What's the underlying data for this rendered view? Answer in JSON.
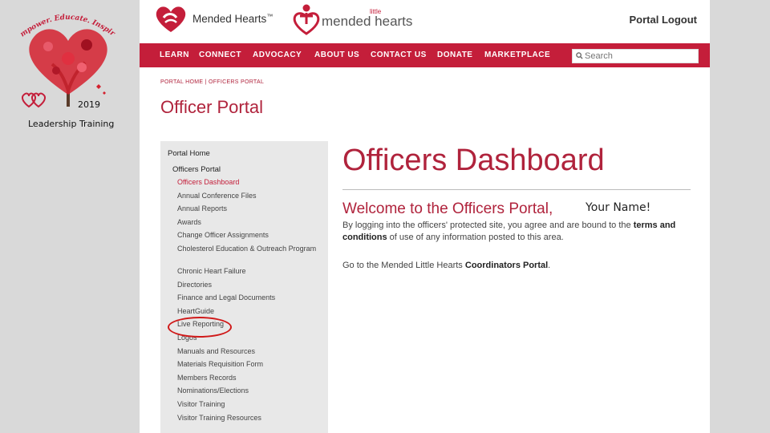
{
  "slide": {
    "arc_text": "Empower. Educate. Inspire.",
    "year": "2019",
    "subtitle": "Leadership Training",
    "colors": {
      "tree": "#d4202e",
      "trunk": "#5a3b2a"
    }
  },
  "header": {
    "logo1_text": "Mended Hearts",
    "logo1_tm": "™",
    "logo2_small": "little",
    "logo2_text": "mended hearts",
    "logout": "Portal Logout"
  },
  "nav": {
    "items": [
      "LEARN",
      "CONNECT",
      "ADVOCACY",
      "ABOUT US",
      "CONTACT US",
      "DONATE",
      "MARKETPLACE"
    ],
    "search_placeholder": "Search",
    "color": "#c41e3a"
  },
  "page": {
    "breadcrumb": "PORTAL HOME | OFFICERS PORTAL",
    "title": "Officer Portal"
  },
  "sidebar": {
    "home": "Portal Home",
    "section": "Officers Portal",
    "items": [
      "Officers Dashboard",
      "Annual Conference Files",
      "Annual Reports",
      "Awards",
      "Change Officer Assignments",
      "Cholesterol Education & Outreach Program",
      "Chronic Heart Failure",
      "Directories",
      "Finance and Legal Documents",
      "HeartGuide",
      "Live Reporting",
      "Logos",
      "Manuals and Resources",
      "Materials Requisition Form",
      "Members Records",
      "Nominations/Elections",
      "Visitor Training",
      "Visitor Training Resources"
    ],
    "active_index": 0,
    "circled_index": 10
  },
  "content": {
    "heading": "Officers Dashboard",
    "welcome": "Welcome to the Officers Portal,",
    "your_name": "Your Name!",
    "p1_before": "By logging into the officers' protected site, you agree and are bound to the ",
    "p1_bold": "terms and conditions",
    "p1_after": " of use of any information posted to this area.",
    "p2_before": "Go to the Mended Little Hearts ",
    "p2_bold": "Coordinators Portal",
    "p2_after": "."
  }
}
